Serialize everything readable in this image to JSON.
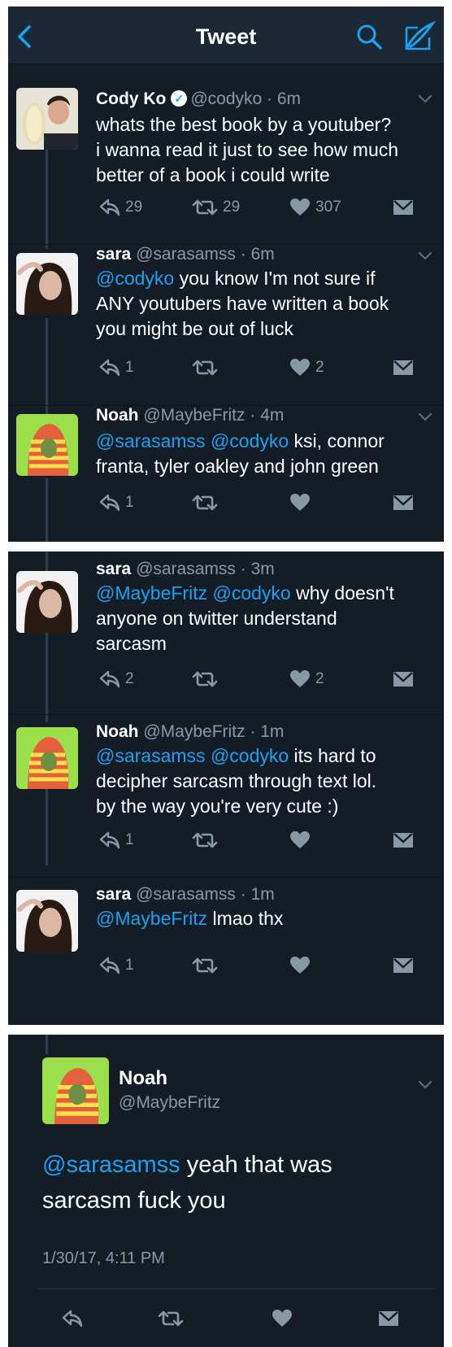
{
  "header": {
    "title": "Tweet"
  },
  "panel1": {
    "tweets": [
      {
        "name": "Cody Ko",
        "verified": true,
        "handle": "@codyko",
        "time": "6m",
        "lines": [
          [
            "whats the best book by a youtuber?"
          ],
          [
            "i wanna read it just to see how much"
          ],
          [
            "better of a book i could write"
          ]
        ],
        "reply_count": "29",
        "retweet_count": "29",
        "like_count": "307"
      },
      {
        "name": "sara",
        "handle": "@sarasamss",
        "time": "6m",
        "mentions": [
          "@codyko"
        ],
        "text_parts": [
          " you know I'm not sure if",
          "ANY youtubers have written a book",
          "you might be out of luck"
        ],
        "reply_count": "1",
        "retweet_count": "",
        "like_count": "2"
      },
      {
        "name": "Noah",
        "handle": "@MaybeFritz",
        "time": "4m",
        "mentions": [
          "@sarasamss",
          "@codyko"
        ],
        "text_parts": [
          " ksi, connor",
          "franta, tyler oakley and john green"
        ],
        "reply_count": "1",
        "retweet_count": "",
        "like_count": ""
      }
    ]
  },
  "panel2": {
    "tweets": [
      {
        "name": "sara",
        "handle": "@sarasamss",
        "time": "3m",
        "mentions": [
          "@MaybeFritz",
          "@codyko"
        ],
        "text_parts": [
          " why doesn't",
          "anyone on twitter understand",
          "sarcasm"
        ],
        "reply_count": "2",
        "retweet_count": "",
        "like_count": "2"
      },
      {
        "name": "Noah",
        "handle": "@MaybeFritz",
        "time": "1m",
        "mentions": [
          "@sarasamss",
          "@codyko"
        ],
        "text_parts": [
          " its hard to",
          "decipher sarcasm through text lol.",
          "by the way you're very cute :)"
        ],
        "reply_count": "1",
        "retweet_count": "",
        "like_count": ""
      },
      {
        "name": "sara",
        "handle": "@sarasamss",
        "time": "1m",
        "mentions": [
          "@MaybeFritz"
        ],
        "text_parts": [
          " lmao thx"
        ],
        "reply_count": "1",
        "retweet_count": "",
        "like_count": ""
      }
    ]
  },
  "panel3": {
    "name": "Noah",
    "handle": "@MaybeFritz",
    "mention": "@sarasamss",
    "text_parts": [
      " yeah that was",
      "sarcasm fuck you"
    ],
    "timestamp": "1/30/17, 4:11 PM"
  },
  "colors": {
    "background": "#141d26",
    "header": "#1b2836",
    "accent": "#1da1f2",
    "muted": "#8899a6"
  },
  "icons": [
    "back-chevron-icon",
    "search-icon",
    "compose-icon",
    "reply-icon",
    "retweet-icon",
    "heart-icon",
    "direct-message-icon",
    "caret-down-icon",
    "verified-badge-icon"
  ]
}
